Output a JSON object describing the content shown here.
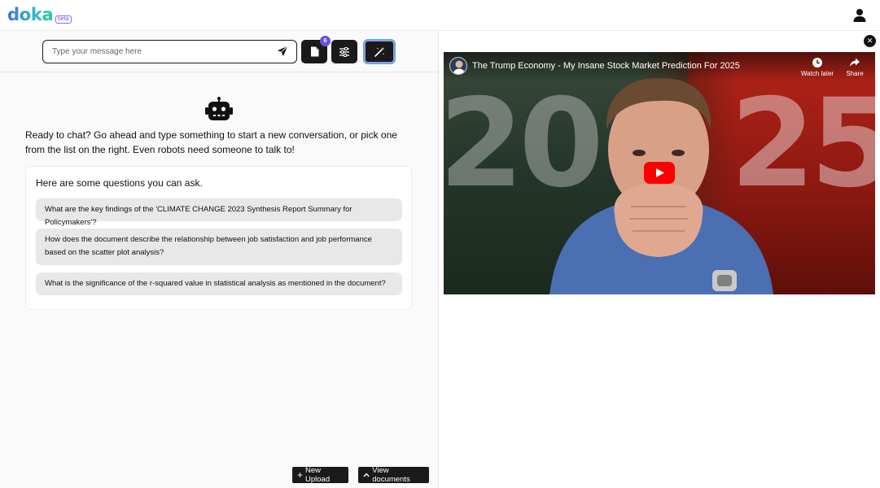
{
  "app": {
    "logo": "doka",
    "beta_label": "beta"
  },
  "header": {
    "user_icon": "user-icon"
  },
  "chat": {
    "input_placeholder": "Type your message here",
    "input_value": "",
    "doc_count": "6",
    "icons": {
      "send": "paper-plane-icon",
      "docs": "document-icon",
      "settings": "sliders-icon",
      "magic": "magic-wand-icon"
    },
    "intro_text": "Ready to chat? Go ahead and type something to start a new conversation, or pick one from the list on the right. Even robots need someone to talk to!",
    "questions_title": "Here are some questions you can ask.",
    "questions": [
      "What are the key findings of the 'CLIMATE CHANGE 2023 Synthesis Report Summary for Policymakers'?",
      "How does the document describe the relationship between job satisfaction and job performance based on the scatter plot analysis?",
      "What is the significance of the r-squared value in statistical analysis as mentioned in the document?"
    ],
    "new_upload_label": "New Upload",
    "view_documents_label": "View documents"
  },
  "video": {
    "title": "The Trump Economy - My Insane Stock Market Prediction For 2025",
    "watch_later_label": "Watch later",
    "share_label": "Share",
    "thumb_left_text": "20",
    "thumb_right_text": "25"
  },
  "colors": {
    "accent": "#6a4fe6",
    "logo_start": "#3b6ff0",
    "logo_end": "#27c8a0",
    "dark_button": "#1a1a1a",
    "youtube_red": "#ff0000"
  }
}
